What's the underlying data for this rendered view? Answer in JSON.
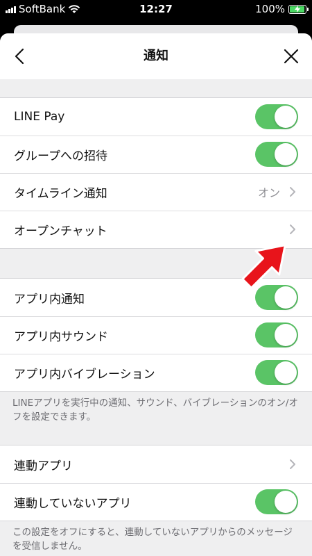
{
  "status_bar": {
    "carrier": "SoftBank",
    "time": "12:27",
    "battery": "100%",
    "battery_level": 1.0,
    "icons": [
      "signal-icon",
      "wifi-icon",
      "battery-charging-icon"
    ]
  },
  "navbar": {
    "title": "通知",
    "back_icon": "chevron-left-icon",
    "close_icon": "close-icon"
  },
  "sections": {
    "group1": [
      {
        "label": "LINE Pay",
        "control": "toggle",
        "on": true
      },
      {
        "label": "グループへの招待",
        "control": "toggle",
        "on": true
      },
      {
        "label": "タイムライン通知",
        "control": "link",
        "value": "オン"
      },
      {
        "label": "オープンチャット",
        "control": "link",
        "value": ""
      }
    ],
    "group2": [
      {
        "label": "アプリ内通知",
        "control": "toggle",
        "on": true
      },
      {
        "label": "アプリ内サウンド",
        "control": "toggle",
        "on": true
      },
      {
        "label": "アプリ内バイブレーション",
        "control": "toggle",
        "on": true
      }
    ],
    "group2_note": "LINEアプリを実行中の通知、サウンド、バイブレーションのオン/オフを設定できます。",
    "group3": [
      {
        "label": "連動アプリ",
        "control": "link",
        "value": ""
      },
      {
        "label": "連動していないアプリ",
        "control": "toggle",
        "on": true
      }
    ],
    "group3_note": "この設定をオフにすると、連動していないアプリからのメッセージを受信しません。"
  },
  "colors": {
    "toggle_on": "#5ac466",
    "annotation_arrow": "#e8141b"
  },
  "annotation": {
    "icon": "red-arrow-icon",
    "points_to": "オープンチャット"
  }
}
